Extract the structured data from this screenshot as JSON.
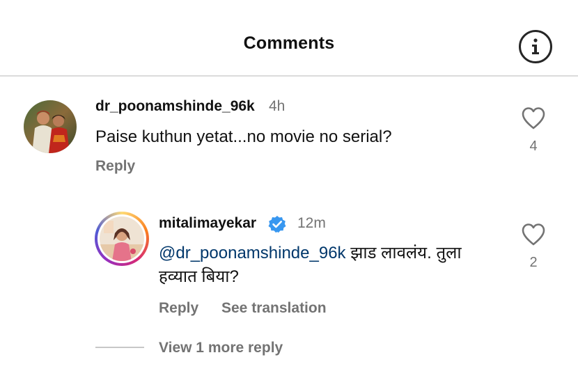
{
  "header": {
    "title": "Comments",
    "info_icon": "info-circle-icon"
  },
  "comments": [
    {
      "username": "dr_poonamshinde_96k",
      "time": "4h",
      "text": "Paise kuthun yetat...no movie no serial?",
      "reply_label": "Reply",
      "like_count": "4",
      "like_icon": "heart-outline-icon"
    }
  ],
  "reply": {
    "username": "mitalimayekar",
    "verified_icon": "verified-badge-icon",
    "time": "12m",
    "mention": "@dr_poonamshinde_96k",
    "text_line1": " झाड लावलंय. तुला",
    "text_line2": "हव्यात बिया?",
    "reply_label": "Reply",
    "see_translation_label": "See translation",
    "like_count": "2",
    "like_icon": "heart-outline-icon"
  },
  "more_replies": {
    "label": "View 1 more reply"
  },
  "colors": {
    "text_primary": "#111111",
    "text_secondary": "#737373",
    "mention": "#00376b",
    "verified": "#3897f0",
    "divider": "#dbdbdb"
  }
}
